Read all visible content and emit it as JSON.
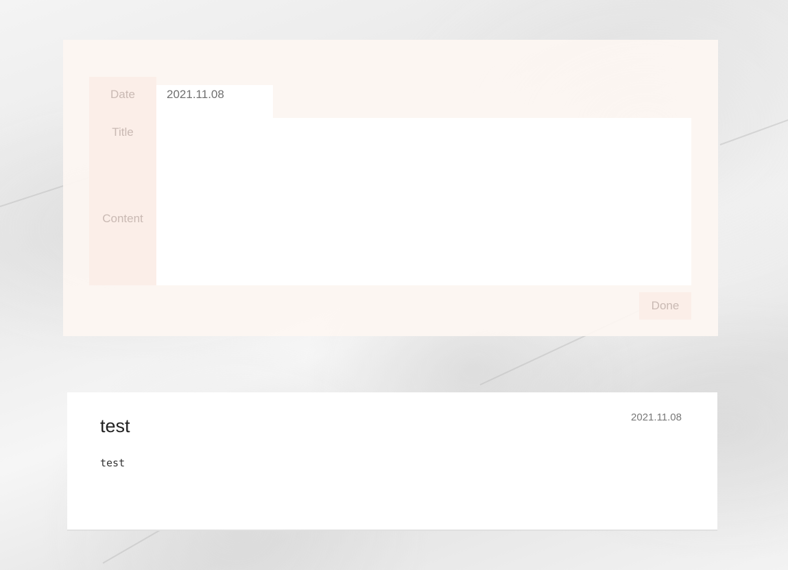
{
  "form": {
    "labels": {
      "date": "Date",
      "title": "Title",
      "content": "Content"
    },
    "date_value": "2021.11.08",
    "title_value": "",
    "content_value": "",
    "done_label": "Done",
    "colors": {
      "label_background": "#fbeee8",
      "label_text": "#c9b9b3",
      "card_background": "#fdf6f2"
    }
  },
  "entries": [
    {
      "title": "test",
      "date": "2021.11.08",
      "body": "test"
    }
  ]
}
